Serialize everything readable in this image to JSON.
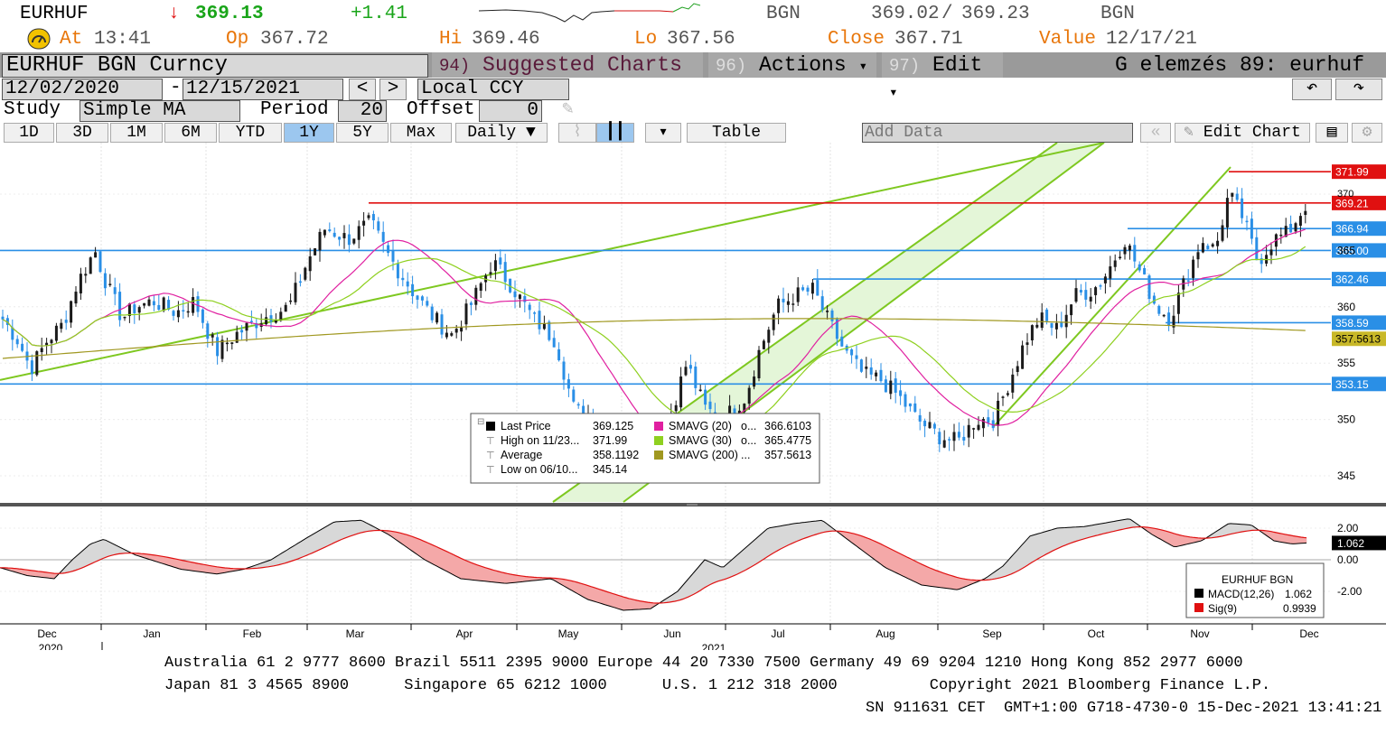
{
  "quote": {
    "ticker": "EURHUF",
    "arrow": "↓",
    "last": "369.13",
    "change": "+1.41",
    "source1": "BGN",
    "bid": "369.02",
    "sep": "/",
    "ask": "369.23",
    "source2": "BGN",
    "at_label": "At",
    "at_time": "13:41",
    "op_label": "Op",
    "op": "367.72",
    "hi_label": "Hi",
    "hi": "369.46",
    "lo_label": "Lo",
    "lo": "367.56",
    "close_label": "Close",
    "close": "367.71",
    "value_label": "Value",
    "value_date": "12/17/21"
  },
  "toolbar": {
    "security": "EURHUF BGN Curncy",
    "suggested_num": "94)",
    "suggested": "Suggested Charts",
    "actions_num": "96)",
    "actions": "Actions",
    "edit_num": "97)",
    "edit": "Edit",
    "title": "G elemzés 89: eurhuf",
    "caret": "▾"
  },
  "range": {
    "start": "12/02/2020",
    "dash": "-",
    "end": "12/15/2021",
    "prev": "<",
    "next": ">",
    "currency": "Local CCY"
  },
  "study": {
    "label": "Study",
    "value": "Simple MA",
    "period_label": "Period",
    "period": "20",
    "offset_label": "Offset",
    "offset": "0"
  },
  "tabs": [
    "1D",
    "3D",
    "1M",
    "6M",
    "YTD",
    "1Y",
    "5Y",
    "Max"
  ],
  "selected_tab": "1Y",
  "frequency": "Daily",
  "table_label": "Table",
  "add_data": "Add Data",
  "edit_chart": "Edit Chart",
  "chart_data": [
    {
      "type": "candlestick",
      "y_ticks": [
        "370",
        "365",
        "360",
        "355",
        "350",
        "345"
      ],
      "ylim": [
        343,
        373
      ],
      "x_tick_labels": [
        "Dec",
        "Jan",
        "Feb",
        "Mar",
        "Apr",
        "May",
        "Jun",
        "Jul",
        "Aug",
        "Sep",
        "Oct",
        "Nov",
        "Dec"
      ],
      "x_year_labels": [
        "2020",
        "2021"
      ],
      "close_series_approx": [
        {
          "date": "Dec 2020",
          "value": 358
        },
        {
          "date": "Jan 2021",
          "value": 359.5
        },
        {
          "date": "Feb 2021",
          "value": 357.5
        },
        {
          "date": "Mar 2021",
          "value": 367.5
        },
        {
          "date": "Apr 2021",
          "value": 361
        },
        {
          "date": "May 2021",
          "value": 352
        },
        {
          "date": "Jun 2021",
          "value": 351
        },
        {
          "date": "Jul 2021",
          "value": 361.5
        },
        {
          "date": "Aug 2021",
          "value": 351.5
        },
        {
          "date": "Sep 2021",
          "value": 349.5
        },
        {
          "date": "Oct 2021",
          "value": 361
        },
        {
          "date": "Nov 2021",
          "value": 369.5
        },
        {
          "date": "Dec 2021",
          "value": 369.13
        }
      ],
      "horizontal_lines": [
        {
          "value": 371.99,
          "label": "371.99",
          "color": "#e01010"
        },
        {
          "value": 369.21,
          "label": "369.21",
          "color": "#e01010"
        },
        {
          "value": 366.94,
          "label": "366.94",
          "color": "#2a8fe6"
        },
        {
          "value": 365.0,
          "label": "365.00",
          "color": "#2a8fe6"
        },
        {
          "value": 362.46,
          "label": "362.46",
          "color": "#2a8fe6"
        },
        {
          "value": 358.59,
          "label": "358.59",
          "color": "#2a8fe6"
        },
        {
          "value": 357.5613,
          "label": "357.5613",
          "color": "#b0a020"
        },
        {
          "value": 353.15,
          "label": "353.15",
          "color": "#2a8fe6"
        }
      ],
      "legend": {
        "last_price_label": "Last Price",
        "last_price": "369.125",
        "high_label": "High on 11/23...",
        "high": "371.99",
        "average_label": "Average",
        "average": "358.1192",
        "low_label": "Low on 06/10...",
        "low": "345.14",
        "sma20_label": "SMAVG (20)",
        "sma20_dots": "o...",
        "sma20": "366.6103",
        "sma30_label": "SMAVG (30)",
        "sma30_dots": "o...",
        "sma30": "365.4775",
        "sma200_label": "SMAVG (200)",
        "sma200_dots": "...",
        "sma200": "357.5613"
      },
      "colors": {
        "up": "#1a1a1a",
        "down": "#2a8fe6",
        "sma20": "#e020a0",
        "sma30": "#8fd020",
        "sma200": "#a09820",
        "trend": "#7ec820",
        "channel_fill": "#e4f6d8"
      }
    },
    {
      "type": "line",
      "y_ticks": [
        "2.00",
        "0.00",
        "-2.00"
      ],
      "ylim": [
        -4,
        3
      ],
      "current_label": "1.062",
      "legend": {
        "title": "EURHUF BGN",
        "macd_label": "MACD(12,26)",
        "macd": "1.062",
        "sig_label": "Sig(9)",
        "sig": "0.9939"
      },
      "colors": {
        "macd": "#000000",
        "signal": "#e01010"
      }
    }
  ],
  "footer": {
    "line1": "Australia 61 2 9777 8600 Brazil 5511 2395 9000 Europe 44 20 7330 7500 Germany 49 69 9204 1210 Hong Kong 852 2977 6000",
    "line2": "Japan 81 3 4565 8900      Singapore 65 6212 1000      U.S. 1 212 318 2000          Copyright 2021 Bloomberg Finance L.P.",
    "line3": "SN 911631 CET  GMT+1:00 G718-4730-0 15-Dec-2021 13:41:21"
  }
}
